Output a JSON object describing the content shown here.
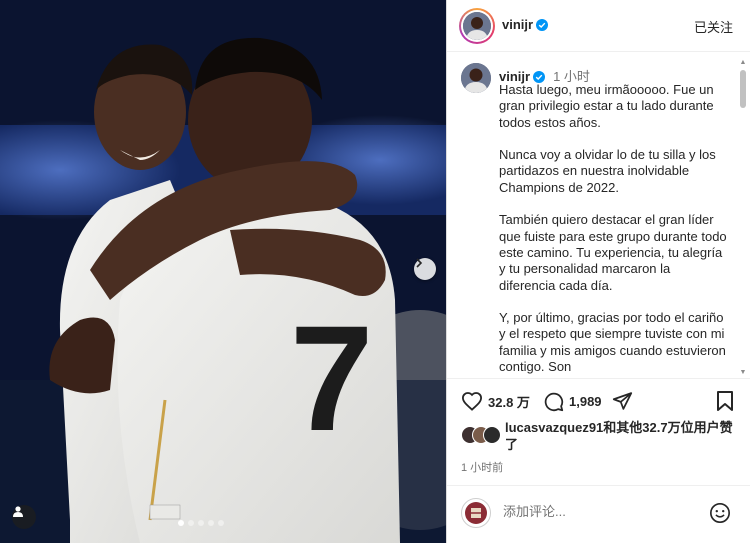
{
  "header": {
    "username": "vinijr",
    "follow_label": "已关注"
  },
  "caption": {
    "username": "vinijr",
    "time": "1 小时",
    "paragraphs": [
      "Hasta luego, meu irmãooooo. Fue un gran privilegio estar a tu lado durante todos estos años.",
      "Nunca voy a olvidar lo de tu silla y los partidazos en nuestra inolvidable Champions de 2022.",
      "También quiero destacar el gran líder que fuiste para este grupo durante todo este camino. Tu experiencia, tu alegría y tu personalidad marcaron la diferencia cada día.",
      "Y, por último, gracias por todo el cariño y el respeto que siempre tuviste con mi familia y mis amigos cuando estuvieron contigo. Son"
    ]
  },
  "actions": {
    "like_count": "32.8 万",
    "comment_count": "1,989"
  },
  "likes": {
    "text": "lucasvazquez91和其他32.7万位用户赞了"
  },
  "posted": "1 小时前",
  "comment": {
    "placeholder": "添加评论..."
  },
  "photo": {
    "jersey_number": "7"
  },
  "colors": {
    "verified": "#0095f6",
    "text": "#262626",
    "muted": "#737373"
  }
}
